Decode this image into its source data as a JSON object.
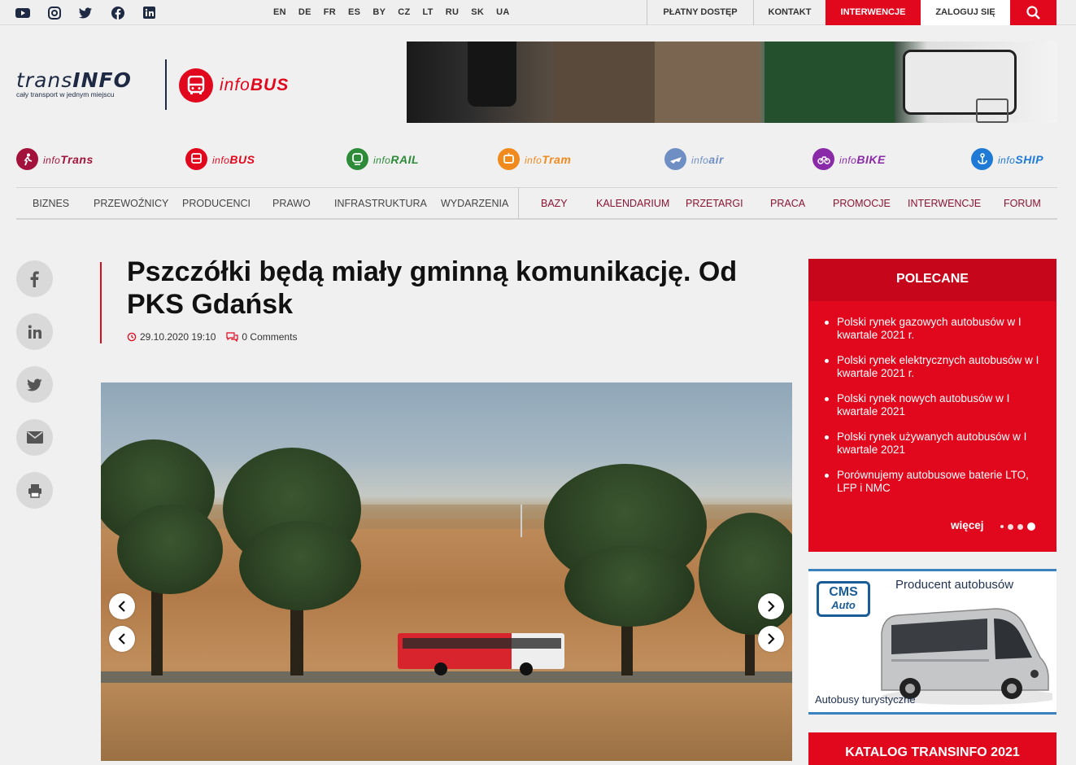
{
  "topbar": {
    "languages": [
      "EN",
      "DE",
      "FR",
      "ES",
      "BY",
      "CZ",
      "LT",
      "RU",
      "SK",
      "UA"
    ],
    "nav": {
      "platny": "PŁATNY DOSTĘP",
      "kontakt": "KONTAKT",
      "interwencje": "INTERWENCJE",
      "zaloguj": "ZALOGUJ SIĘ"
    },
    "social_icons": [
      "youtube-icon",
      "instagram-icon",
      "twitter-icon",
      "facebook-icon",
      "linkedin-icon"
    ]
  },
  "logo": {
    "trans_light": "trans",
    "trans_bold": "INFO",
    "tagline": "cały transport w jednym miejscu",
    "bus_light": "info",
    "bus_bold": "BUS"
  },
  "services": [
    {
      "light": "info",
      "bold": "Trans",
      "color": "#a3123a"
    },
    {
      "light": "info",
      "bold": "BUS",
      "color": "#e1071d"
    },
    {
      "light": "info",
      "bold": "RAIL",
      "color": "#2e8b3a"
    },
    {
      "light": "info",
      "bold": "Tram",
      "color": "#f08a1c"
    },
    {
      "light": "info",
      "bold": "air",
      "color": "#6f8fc4"
    },
    {
      "light": "info",
      "bold": "BIKE",
      "color": "#8a2aa8"
    },
    {
      "light": "info",
      "bold": "SHIP",
      "color": "#1f7ad6"
    }
  ],
  "mainnav": {
    "left": [
      "BIZNES",
      "PRZEWOŹNICY",
      "PRODUCENCI",
      "PRAWO",
      "INFRASTRUKTURA",
      "WYDARZENIA"
    ],
    "right": [
      "BAZY",
      "KALENDARIUM",
      "PRZETARGI",
      "PRACA",
      "PROMOCJE",
      "INTERWENCJE",
      "FORUM"
    ]
  },
  "article": {
    "title": "Pszczółki będą miały gminną komunikację. Od PKS Gdańsk",
    "date": "29.10.2020 19:10",
    "comments": "0 Comments"
  },
  "polecane": {
    "heading": "POLECANE",
    "items": [
      "Polski rynek gazowych autobusów w I kwartale 2021 r.",
      "Polski rynek elektrycznych autobusów w I kwartale 2021 r.",
      "Polski rynek nowych autobusów w I kwartale 2021",
      "Polski rynek używanych autobusów w I kwartale 2021",
      "Porównujemy autobusowe baterie LTO, LFP i NMC"
    ],
    "more": "więcej"
  },
  "ad_cms": {
    "logo_top": "CMS",
    "logo_bottom": "Auto",
    "title": "Producent autobusów",
    "subtitle": "Autobusy turystyczne"
  },
  "katalog": "KATALOG TRANSINFO 2021",
  "colors": {
    "accent": "#e1071d",
    "navy": "#1e2a44",
    "nav_right": "#8a1433"
  }
}
